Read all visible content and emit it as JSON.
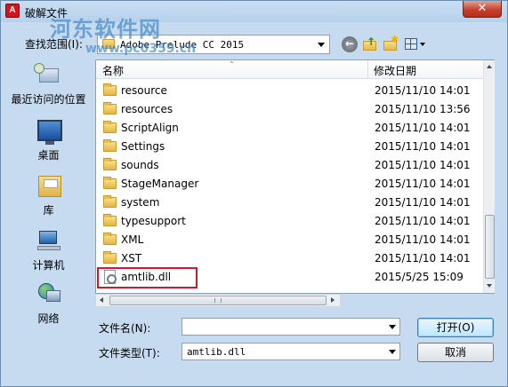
{
  "window": {
    "title": "破解文件",
    "close_glyph": "✕",
    "app_icon": "adobe-icon"
  },
  "watermark": {
    "text": "河东软件网",
    "url": "www.pc0359.cn"
  },
  "toolbar": {
    "look_in_label": "查找范围(I):",
    "look_in_value": "Adobe Prelude CC 2015",
    "back_glyph": "←",
    "up_glyph": "↑",
    "new_glyph": "✱"
  },
  "places": [
    {
      "label": "最近访问的位置",
      "icon": "recent-places-icon"
    },
    {
      "label": "桌面",
      "icon": "desktop-icon"
    },
    {
      "label": "库",
      "icon": "libraries-icon"
    },
    {
      "label": "计算机",
      "icon": "computer-icon"
    },
    {
      "label": "网络",
      "icon": "network-icon"
    }
  ],
  "file_list": {
    "columns": [
      "名称",
      "修改日期"
    ],
    "sort_glyph": "⌃",
    "rows": [
      {
        "name": "resource",
        "date": "2015/11/10 14:01",
        "type": "folder"
      },
      {
        "name": "resources",
        "date": "2015/11/10 13:56",
        "type": "folder"
      },
      {
        "name": "ScriptAlign",
        "date": "2015/11/10 14:01",
        "type": "folder"
      },
      {
        "name": "Settings",
        "date": "2015/11/10 14:01",
        "type": "folder"
      },
      {
        "name": "sounds",
        "date": "2015/11/10 14:01",
        "type": "folder"
      },
      {
        "name": "StageManager",
        "date": "2015/11/10 14:01",
        "type": "folder"
      },
      {
        "name": "system",
        "date": "2015/11/10 14:01",
        "type": "folder"
      },
      {
        "name": "typesupport",
        "date": "2015/11/10 14:01",
        "type": "folder"
      },
      {
        "name": "XML",
        "date": "2015/11/10 14:01",
        "type": "folder"
      },
      {
        "name": "XST",
        "date": "2015/11/10 14:01",
        "type": "folder"
      },
      {
        "name": "amtlib.dll",
        "date": "2015/5/25 15:09",
        "type": "dll"
      }
    ]
  },
  "form": {
    "filename_label": "文件名(N):",
    "filename_value": "",
    "filetype_label": "文件类型(T):",
    "filetype_value": "amtlib.dll",
    "open_label": "打开(O)",
    "cancel_label": "取消"
  },
  "colors": {
    "dialog_bg": "#c6dbef",
    "highlight": "#d2182a",
    "watermark": "#468ccd"
  }
}
